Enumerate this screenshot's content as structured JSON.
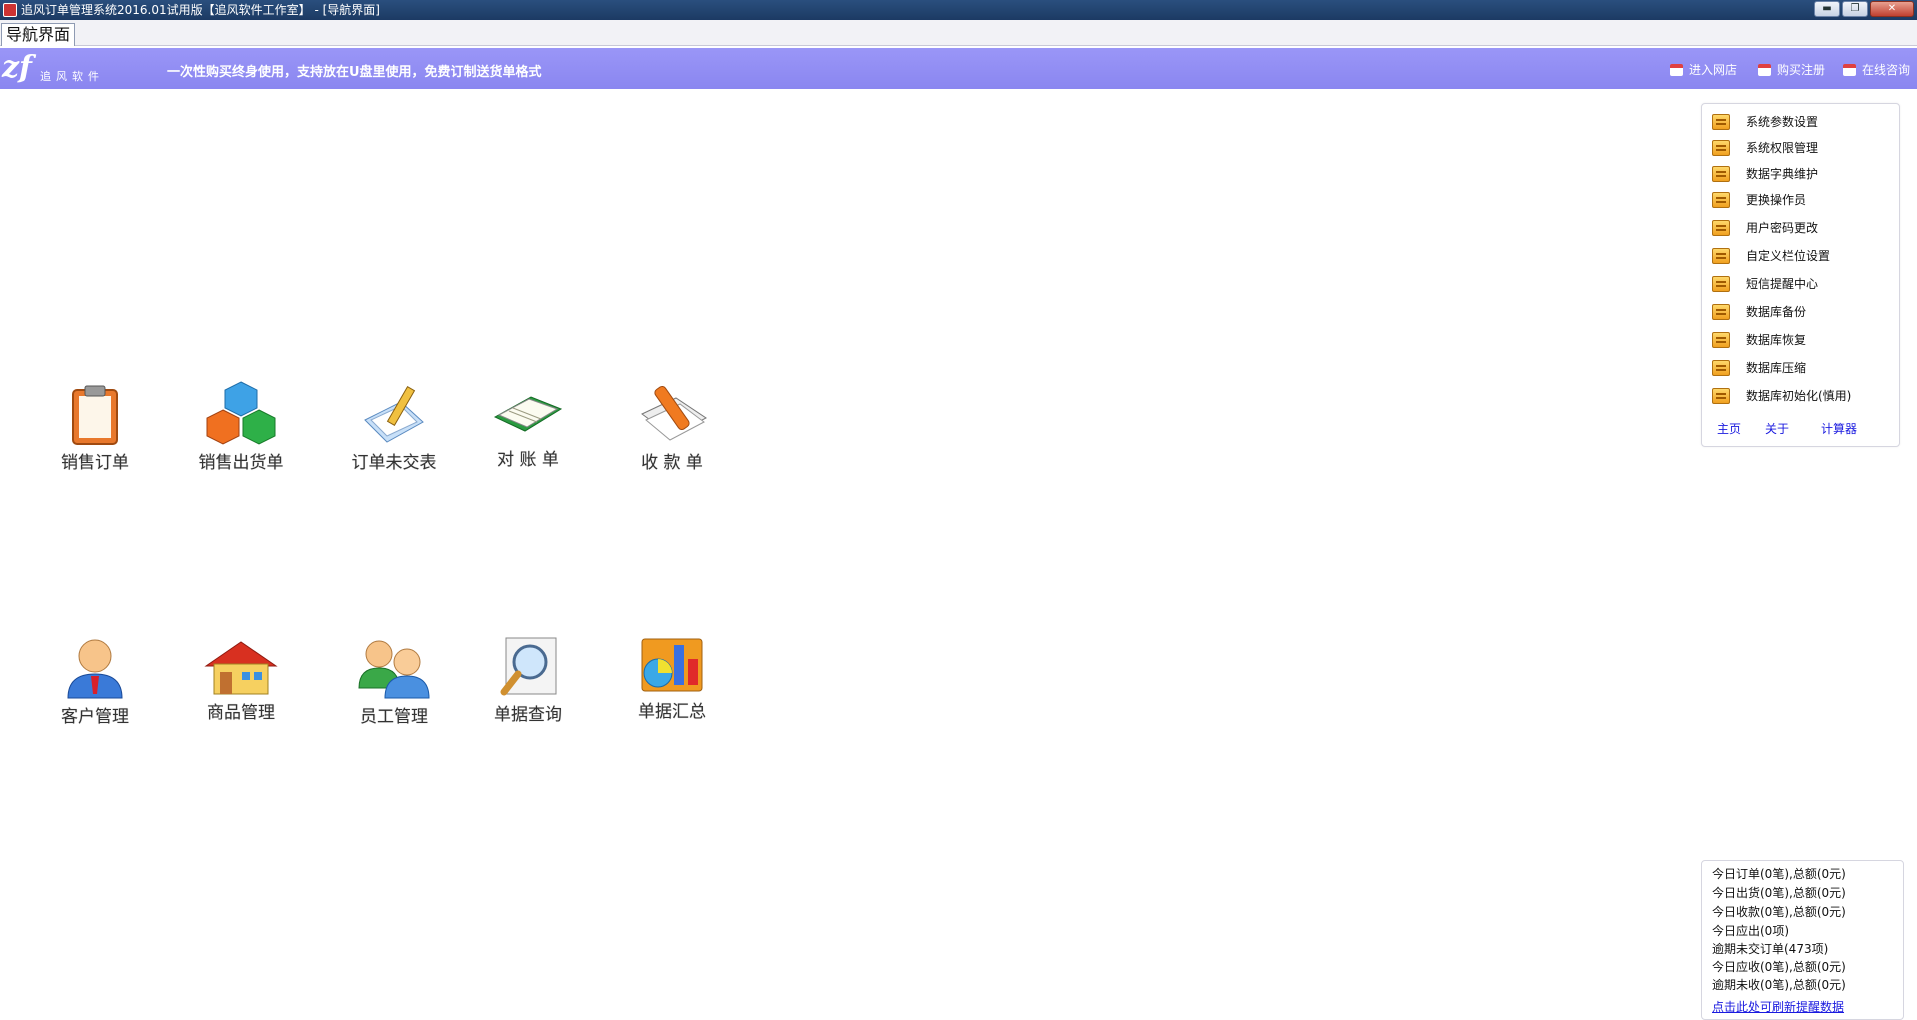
{
  "window": {
    "title": "追风订单管理系统2016.01试用版【追风软件工作室】 - [导航界面]",
    "min_glyph": "▬",
    "max_glyph": "❐",
    "close_glyph": "✕"
  },
  "tabs": [
    {
      "label": "导航界面"
    }
  ],
  "banner": {
    "logo_mark": "zf",
    "logo_text": "追风软件",
    "slogan": "一次性购买终身使用，支持放在U盘里使用，免费订制送货单格式",
    "links": [
      {
        "label": "进入网店",
        "icon": "calendar-icon"
      },
      {
        "label": "购买注册",
        "icon": "calendar-icon"
      },
      {
        "label": "在线咨询",
        "icon": "calendar-icon"
      }
    ]
  },
  "modules": {
    "row1": [
      {
        "label": "销售订单",
        "icon": "clipboard-icon"
      },
      {
        "label": "销售出货单",
        "icon": "cubes-icon"
      },
      {
        "label": "订单未交表",
        "icon": "pencil-paper-icon"
      },
      {
        "label": "对 账 单",
        "icon": "open-book-icon"
      },
      {
        "label": "收 款 单",
        "icon": "pen-docs-icon"
      }
    ],
    "row2": [
      {
        "label": "客户管理",
        "icon": "customer-icon"
      },
      {
        "label": "商品管理",
        "icon": "house-icon"
      },
      {
        "label": "员工管理",
        "icon": "staff-icon"
      },
      {
        "label": "单据查询",
        "icon": "magnifier-icon"
      },
      {
        "label": "单据汇总",
        "icon": "chart-icon"
      }
    ]
  },
  "side_menu": {
    "items": [
      {
        "label": "系统参数设置"
      },
      {
        "label": "系统权限管理"
      },
      {
        "label": "数据字典维护"
      },
      {
        "label": "更换操作员"
      },
      {
        "label": "用户密码更改"
      },
      {
        "label": "自定义栏位设置"
      },
      {
        "label": "短信提醒中心"
      },
      {
        "label": "数据库备份"
      },
      {
        "label": "数据库恢复"
      },
      {
        "label": "数据库压缩"
      },
      {
        "label": "数据库初始化(慎用)"
      }
    ],
    "footer": {
      "home": "主页",
      "about": "关于",
      "calculator": "计算器"
    }
  },
  "stats": {
    "lines": [
      "今日订单(0笔),总额(0元)",
      "今日出货(0笔),总额(0元)",
      "今日收款(0笔),总额(0元)",
      "今日应出(0项)",
      "逾期未交订单(473项)",
      "今日应收(0笔),总额(0元)",
      "逾期未收(0笔),总额(0元)"
    ],
    "refresh": "点击此处可刷新提醒数据"
  }
}
